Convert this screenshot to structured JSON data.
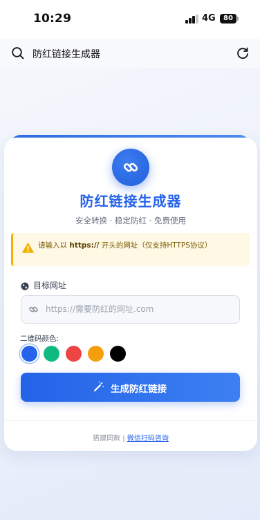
{
  "status_bar": {
    "time": "10:29",
    "network": "4G",
    "battery": "80"
  },
  "browser": {
    "page_title": "防红链接生成器",
    "icons": {
      "search": "search-icon",
      "refresh": "refresh-icon"
    }
  },
  "card": {
    "logo_icon": "link-icon",
    "title": "防红链接生成器",
    "subtitle": "安全转换 · 稳定防红 · 免费使用",
    "notice": {
      "prefix": "请输入以 ",
      "highlight": "https://",
      "suffix": " 开头的网址（仅支持HTTPS协议）",
      "icon": "warning-icon"
    },
    "url_field": {
      "label": "目标网址",
      "label_icon": "globe-icon",
      "placeholder": "https://需要防红的网址.com",
      "value": ""
    },
    "qr_color": {
      "label": "二维码颜色:",
      "options": [
        "#2563eb",
        "#10b981",
        "#ef4444",
        "#f59e0b",
        "#000000"
      ],
      "selected": "#2563eb"
    },
    "generate_button": {
      "label": "生成防红链接",
      "icon": "magic-wand-icon"
    },
    "footer": {
      "text": "搭建同款 | ",
      "link": "微信扫码咨询"
    }
  },
  "colors": {
    "accent": "#2563eb",
    "notice_bg": "#fff8e5",
    "notice_border": "#f2b300"
  }
}
